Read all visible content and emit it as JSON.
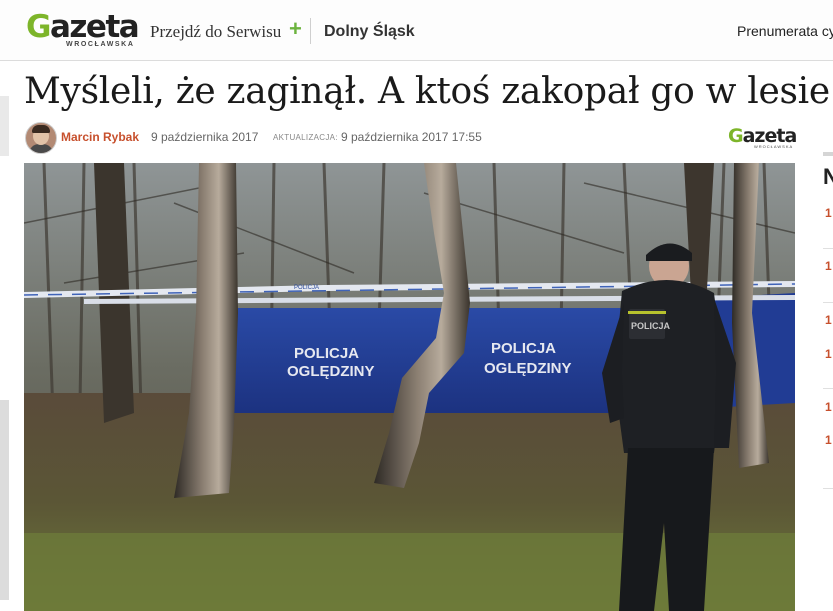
{
  "header": {
    "logo_text": "Gazeta",
    "logo_subtext": "WROCŁAWSKA",
    "nav_link": "Przejdź do Serwisu",
    "nav_plus": "+",
    "region": "Dolny Śląsk",
    "subscribe": "Prenumerata cy"
  },
  "article": {
    "headline": "Myśleli, że zaginął. A ktoś zakopał go w lesie",
    "author": "Marcin Rybak",
    "published": "9 października 2017",
    "update_label": "AKTUALIZACJA:",
    "updated": "9 października 2017 17:55",
    "source_logo_text": "Gazeta",
    "source_logo_subtext": "WROCŁAWSKA"
  },
  "photo": {
    "screen_text_1": "POLICJA",
    "screen_text_2": "OGLĘDZINY",
    "tape_text": "POLICJA",
    "patch_text": "POLICJA"
  },
  "sidebar": {
    "heading_letter": "N",
    "numbers": [
      "1",
      "1",
      "1",
      "1",
      "1",
      "1"
    ]
  },
  "colors": {
    "accent_green": "#7db52a",
    "author_red": "#c7502d",
    "screen_blue": "#1f3a8c"
  }
}
